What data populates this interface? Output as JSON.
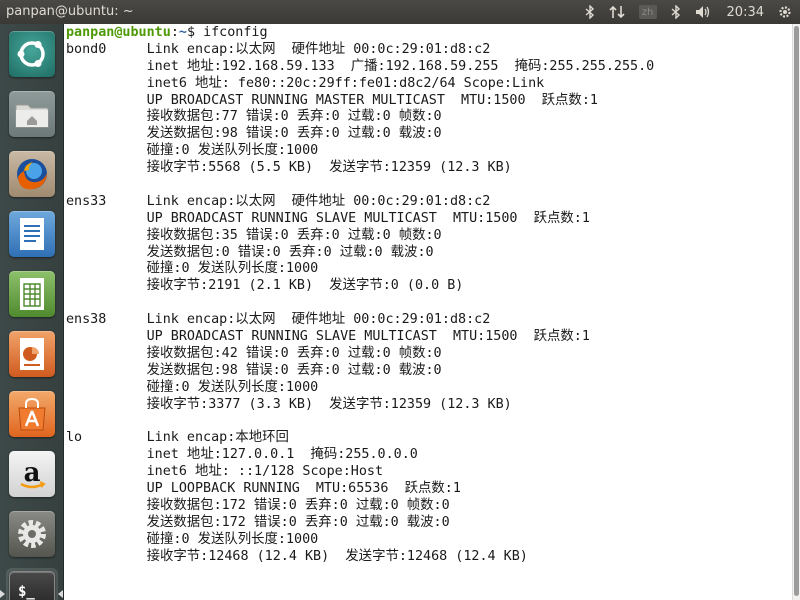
{
  "panel": {
    "title": "panpan@ubuntu: ~",
    "clock": "20:34",
    "kb_label": "zh"
  },
  "launcher": {
    "items": [
      "dash",
      "files",
      "firefox",
      "writer",
      "calc",
      "impress",
      "software-center",
      "amazon",
      "system-settings",
      "terminal"
    ]
  },
  "terminal": {
    "prompt_user": "panpan@ubuntu",
    "prompt_path": "~",
    "prompt_sep": ":",
    "prompt_end": "$ ",
    "command": "ifconfig",
    "lines": [
      "bond0     Link encap:以太网  硬件地址 00:0c:29:01:d8:c2",
      "          inet 地址:192.168.59.133  广播:192.168.59.255  掩码:255.255.255.0",
      "          inet6 地址: fe80::20c:29ff:fe01:d8c2/64 Scope:Link",
      "          UP BROADCAST RUNNING MASTER MULTICAST  MTU:1500  跃点数:1",
      "          接收数据包:77 错误:0 丢弃:0 过载:0 帧数:0",
      "          发送数据包:98 错误:0 丢弃:0 过载:0 载波:0",
      "          碰撞:0 发送队列长度:1000",
      "          接收字节:5568 (5.5 KB)  发送字节:12359 (12.3 KB)",
      "",
      "ens33     Link encap:以太网  硬件地址 00:0c:29:01:d8:c2",
      "          UP BROADCAST RUNNING SLAVE MULTICAST  MTU:1500  跃点数:1",
      "          接收数据包:35 错误:0 丢弃:0 过载:0 帧数:0",
      "          发送数据包:0 错误:0 丢弃:0 过载:0 载波:0",
      "          碰撞:0 发送队列长度:1000",
      "          接收字节:2191 (2.1 KB)  发送字节:0 (0.0 B)",
      "",
      "ens38     Link encap:以太网  硬件地址 00:0c:29:01:d8:c2",
      "          UP BROADCAST RUNNING SLAVE MULTICAST  MTU:1500  跃点数:1",
      "          接收数据包:42 错误:0 丢弃:0 过载:0 帧数:0",
      "          发送数据包:98 错误:0 丢弃:0 过载:0 载波:0",
      "          碰撞:0 发送队列长度:1000",
      "          接收字节:3377 (3.3 KB)  发送字节:12359 (12.3 KB)",
      "",
      "lo        Link encap:本地环回",
      "          inet 地址:127.0.0.1  掩码:255.0.0.0",
      "          inet6 地址: ::1/128 Scope:Host",
      "          UP LOOPBACK RUNNING  MTU:65536  跃点数:1",
      "          接收数据包:172 错误:0 丢弃:0 过载:0 帧数:0",
      "          发送数据包:172 错误:0 丢弃:0 过载:0 载波:0",
      "          碰撞:0 发送队列长度:1000",
      "          接收字节:12468 (12.4 KB)  发送字节:12468 (12.4 KB)"
    ]
  },
  "colors": {
    "prompt_user": "#4e9a06",
    "prompt_path": "#3465a4",
    "terminal_bg": "#ffffff",
    "panel_bg": "#3c3b37"
  }
}
